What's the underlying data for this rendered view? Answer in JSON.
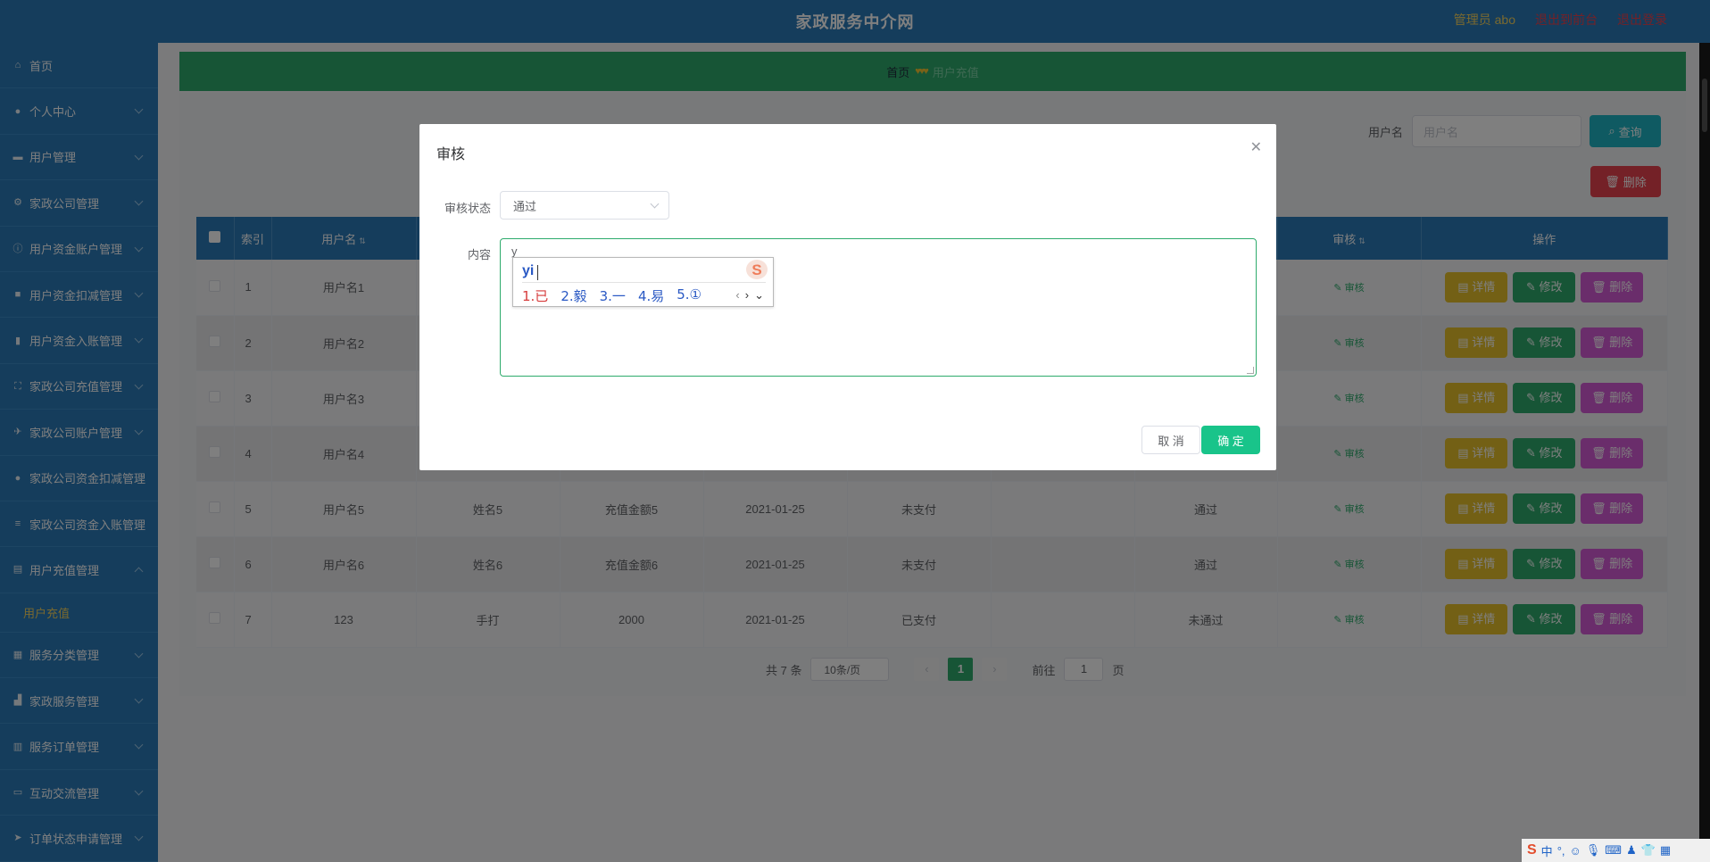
{
  "header": {
    "title": "家政服务中介网",
    "admin": "管理员 abo",
    "back_front": "退出到前台",
    "logout": "退出登录"
  },
  "sidebar": {
    "items": [
      {
        "label": "首页",
        "icon": "home-icon"
      },
      {
        "label": "个人中心",
        "icon": "user-icon"
      },
      {
        "label": "用户管理",
        "icon": "id-card-icon"
      },
      {
        "label": "家政公司管理",
        "icon": "settings-icon"
      },
      {
        "label": "用户资金账户管理",
        "icon": "info-icon"
      },
      {
        "label": "用户资金扣减管理",
        "icon": "box-icon"
      },
      {
        "label": "用户资金入账管理",
        "icon": "trash-icon"
      },
      {
        "label": "家政公司充值管理",
        "icon": "full-screen-icon"
      },
      {
        "label": "家政公司账户管理",
        "icon": "plane-icon"
      },
      {
        "label": "家政公司资金扣减管理",
        "icon": "person-icon"
      },
      {
        "label": "家政公司资金入账管理",
        "icon": "list-icon"
      },
      {
        "label": "用户充值管理",
        "icon": "doc-icon"
      }
    ],
    "sub_item": "用户充值",
    "items2": [
      {
        "label": "服务分类管理",
        "icon": "grid-icon"
      },
      {
        "label": "家政服务管理",
        "icon": "chart-icon"
      },
      {
        "label": "服务订单管理",
        "icon": "bar-chart-icon"
      },
      {
        "label": "互动交流管理",
        "icon": "tablet-icon"
      },
      {
        "label": "订单状态申请管理",
        "icon": "send-icon"
      }
    ]
  },
  "breadcrumb": {
    "home": "首页",
    "current": "用户充值"
  },
  "search": {
    "label": "用户名",
    "placeholder": "用户名",
    "query_button": "查询",
    "delete_button": "删除"
  },
  "table": {
    "headers": [
      "",
      "索引",
      "用户名",
      "",
      "",
      "",
      "",
      "",
      "",
      "审核",
      "操作"
    ],
    "rows": [
      {
        "index": "1",
        "username": "用户名1",
        "name": "",
        "amount": "",
        "date": "",
        "pay": "",
        "reply": "",
        "status": ""
      },
      {
        "index": "2",
        "username": "用户名2",
        "name": "",
        "amount": "",
        "date": "",
        "pay": "",
        "reply": "",
        "status": ""
      },
      {
        "index": "3",
        "username": "用户名3",
        "name": "",
        "amount": "",
        "date": "",
        "pay": "",
        "reply": "",
        "status": ""
      },
      {
        "index": "4",
        "username": "用户名4",
        "name": "",
        "amount": "",
        "date": "",
        "pay": "",
        "reply": "",
        "status": ""
      },
      {
        "index": "5",
        "username": "用户名5",
        "name": "姓名5",
        "amount": "充值金额5",
        "date": "2021-01-25",
        "pay": "未支付",
        "reply": "",
        "status": "通过"
      },
      {
        "index": "6",
        "username": "用户名6",
        "name": "姓名6",
        "amount": "充值金额6",
        "date": "2021-01-25",
        "pay": "未支付",
        "reply": "",
        "status": "通过"
      },
      {
        "index": "7",
        "username": "123",
        "name": "手打",
        "amount": "2000",
        "date": "2021-01-25",
        "pay": "已支付",
        "reply": "",
        "status": "未通过"
      }
    ],
    "audit_link": "审核",
    "detail_button": "详情",
    "edit_button": "修改",
    "delete_button": "删除"
  },
  "pager": {
    "total": "共 7 条",
    "page_size": "10条/页",
    "current": "1",
    "goto_label": "前往",
    "goto_value": "1",
    "page_unit": "页"
  },
  "dialog": {
    "title": "审核",
    "status_label": "审核状态",
    "status_value": "通过",
    "content_label": "内容",
    "content_value": "y",
    "cancel": "取 消",
    "confirm": "确 定"
  },
  "ime": {
    "pinyin": "yi",
    "candidates": [
      "1.已",
      "2.毅",
      "3.一",
      "4.易",
      "5.①"
    ]
  },
  "tray": {
    "lang": "中",
    "punct": "°,"
  }
}
